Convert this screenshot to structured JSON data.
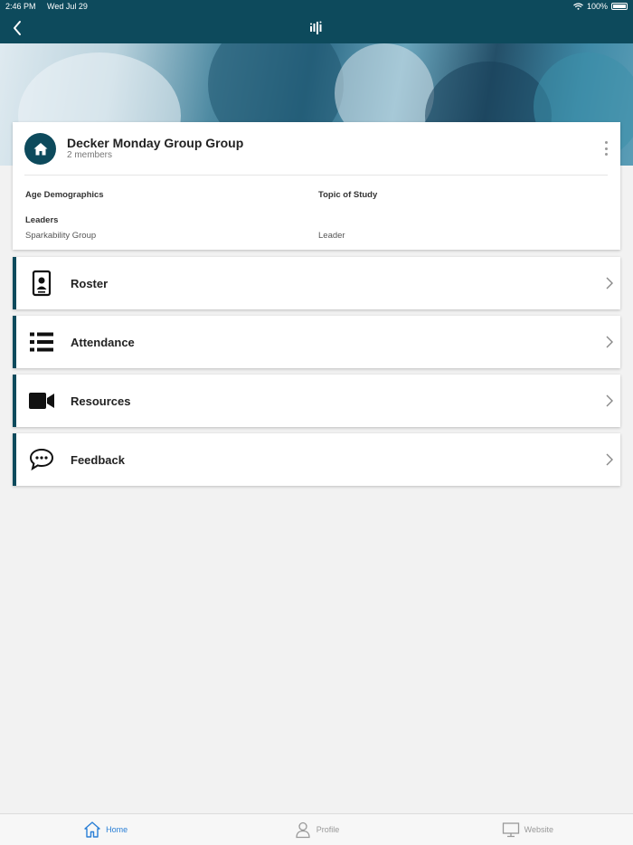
{
  "status_bar": {
    "time": "2:46 PM",
    "date": "Wed Jul 29",
    "battery": "100%"
  },
  "group": {
    "title": "Decker Monday Group Group",
    "members": "2 members",
    "age_label": "Age Demographics",
    "topic_label": "Topic of Study",
    "leaders_label": "Leaders",
    "leader_name": "Sparkability Group",
    "leader_role": "Leader"
  },
  "menu": [
    {
      "label": "Roster",
      "icon": "id-badge-icon"
    },
    {
      "label": "Attendance",
      "icon": "list-icon"
    },
    {
      "label": "Resources",
      "icon": "video-camera-icon"
    },
    {
      "label": "Feedback",
      "icon": "chat-bubble-icon"
    }
  ],
  "tabs": [
    {
      "label": "Home",
      "icon": "home-icon",
      "active": true
    },
    {
      "label": "Profile",
      "icon": "person-icon",
      "active": false
    },
    {
      "label": "Website",
      "icon": "monitor-icon",
      "active": false
    }
  ],
  "colors": {
    "brand": "#0d4a5c",
    "active_tab": "#2a7fd6",
    "background": "#f2f2f2"
  }
}
